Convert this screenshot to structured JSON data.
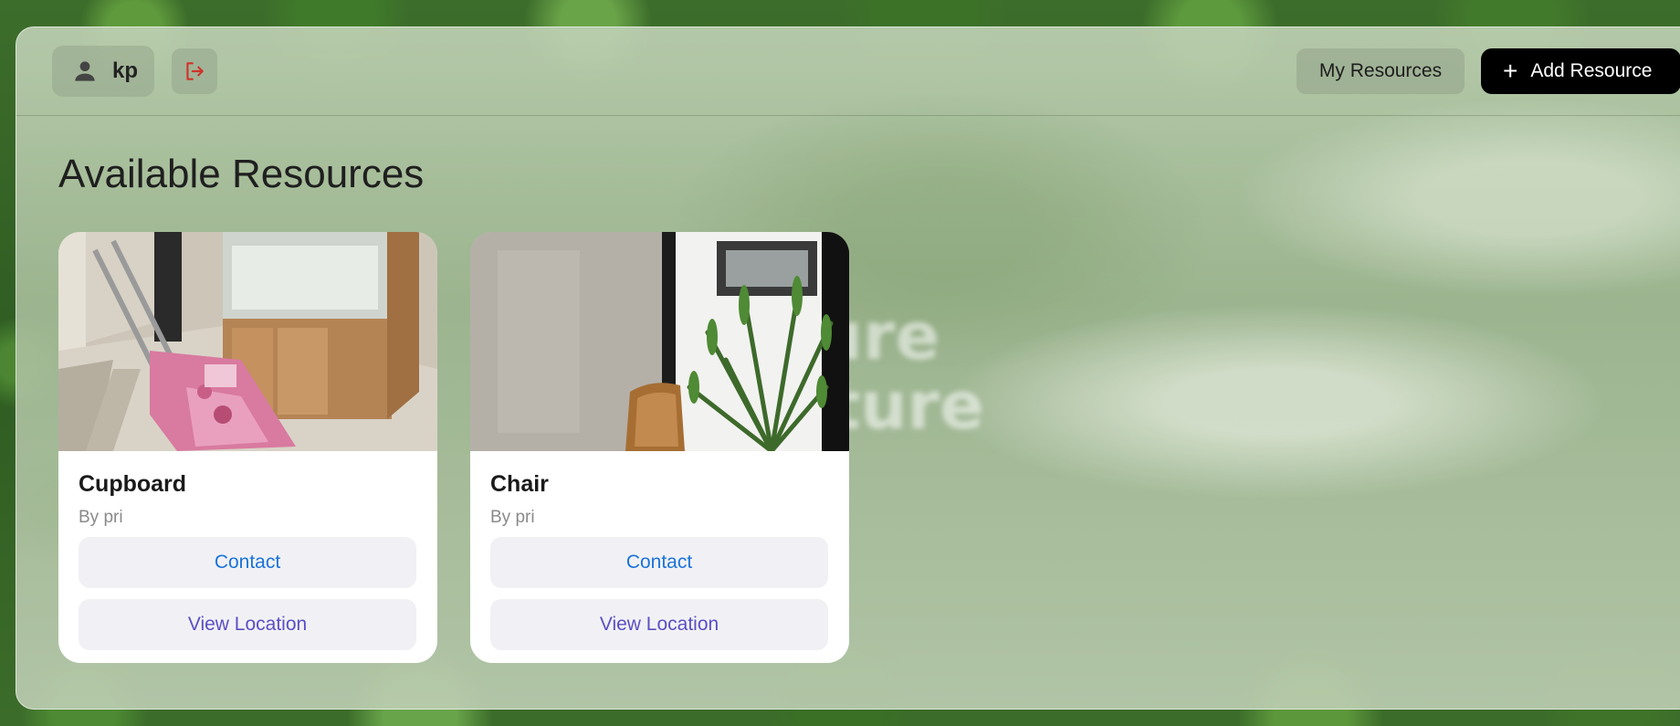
{
  "user": {
    "name": "kp",
    "icon": "person-icon"
  },
  "logout": {
    "icon": "logout-icon",
    "color": "#d0342c"
  },
  "nav": {
    "my_resources_label": "My Resources",
    "add_resource_label": "Add Resource",
    "add_icon": "plus-icon"
  },
  "main": {
    "title": "Available Resources",
    "background_text": [
      "uture",
      "nature"
    ]
  },
  "cards": [
    {
      "title": "Cupboard",
      "owner": "By pri",
      "image": "cupboard-photo",
      "contact_label": "Contact",
      "location_label": "View Location"
    },
    {
      "title": "Chair",
      "owner": "By pri",
      "image": "chair-photo",
      "contact_label": "Contact",
      "location_label": "View Location"
    }
  ],
  "colors": {
    "contact": "#1a73d9",
    "location": "#5b4fc4",
    "add_button_bg": "#000000"
  }
}
